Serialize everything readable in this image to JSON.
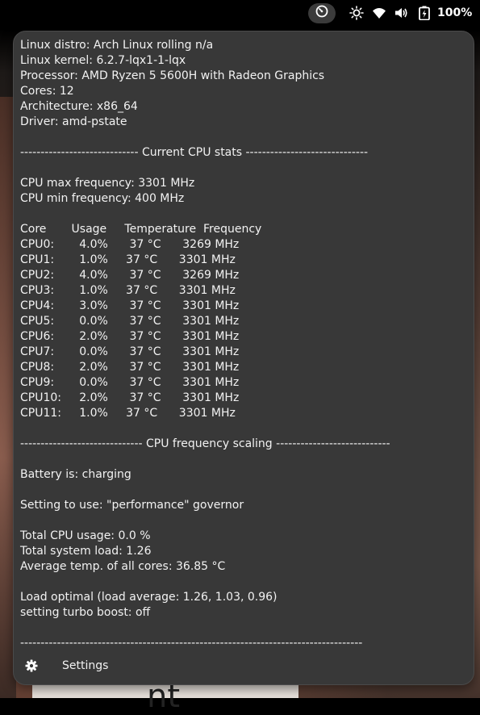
{
  "topbar": {
    "indicator_icon": "gauge-icon",
    "status_icons": [
      "brightness-icon",
      "wifi-icon",
      "volume-icon",
      "battery-charging-icon"
    ],
    "battery_percent": "100%"
  },
  "report": {
    "lines": [
      "Linux distro: Arch Linux rolling n/a",
      "Linux kernel: 6.2.7-lqx1-1-lqx",
      "Processor: AMD Ryzen 5 5600H with Radeon Graphics",
      "Cores: 12",
      "Architecture: x86_64",
      "Driver: amd-pstate",
      "",
      "----------------------------- Current CPU stats ------------------------------",
      "",
      "CPU max frequency: 3301 MHz",
      "CPU min frequency: 400 MHz",
      "",
      "Core       Usage     Temperature  Frequency",
      "CPU0:       4.0%      37 °C      3269 MHz",
      "CPU1:       1.0%     37 °C      3301 MHz",
      "CPU2:       4.0%      37 °C      3269 MHz",
      "CPU3:       1.0%     37 °C      3301 MHz",
      "CPU4:       3.0%      37 °C      3301 MHz",
      "CPU5:       0.0%      37 °C      3301 MHz",
      "CPU6:       2.0%      37 °C      3301 MHz",
      "CPU7:       0.0%      37 °C      3301 MHz",
      "CPU8:       2.0%      37 °C      3301 MHz",
      "CPU9:       0.0%      37 °C      3301 MHz",
      "CPU10:     2.0%      37 °C      3301 MHz",
      "CPU11:     1.0%     37 °C      3301 MHz",
      "",
      "------------------------------ CPU frequency scaling ----------------------------",
      "",
      "Battery is: charging",
      "",
      "Setting to use: \"performance\" governor",
      "",
      "Total CPU usage: 0.0 %",
      "Total system load: 1.26",
      "Average temp. of all cores: 36.85 °C",
      "",
      "Load optimal (load average: 1.26, 1.03, 0.96)",
      "setting turbo boost: off",
      "",
      "------------------------------------------------------------------------------------"
    ]
  },
  "settings": {
    "label": "Settings",
    "icon": "gear-icon"
  }
}
